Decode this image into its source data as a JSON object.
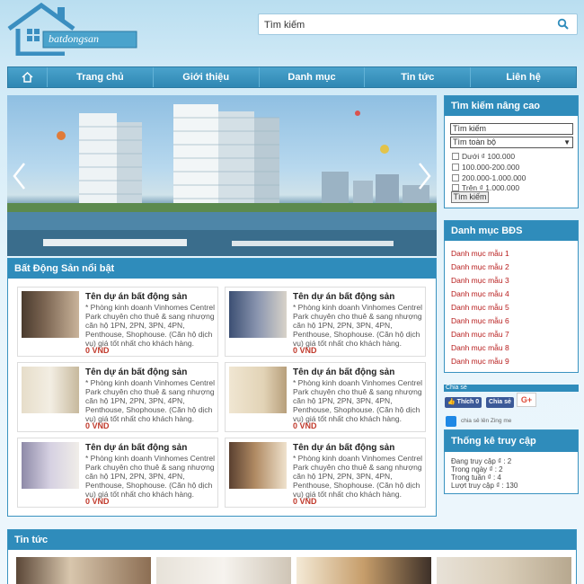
{
  "header": {
    "logo_text": "batdongsan",
    "search_placeholder": "Tìm kiếm",
    "search_icon": "search-icon"
  },
  "nav": {
    "home_icon": "home-icon",
    "items": [
      "Trang chủ",
      "Giới thiệu",
      "Danh mục",
      "Tin tức",
      "Liên hệ"
    ]
  },
  "slider": {
    "prev_icon": "chevron-left-icon",
    "next_icon": "chevron-right-icon"
  },
  "featured": {
    "title": "Bất Động Sản nổi bật",
    "cards": [
      {
        "title": "Tên dự án bất động sản",
        "desc": "* Phòng kinh doanh Vinhomes Centrel Park chuyên cho thuê & sang nhượng căn hộ 1PN, 2PN, 3PN, 4PN, Penthouse, Shophouse. (Căn hộ dịch vụ) giá tốt nhất cho khách hàng.",
        "price": "0 VND"
      },
      {
        "title": "Tên dự án bất động sản",
        "desc": "* Phòng kinh doanh Vinhomes Centrel Park chuyên cho thuê & sang nhượng căn hộ 1PN, 2PN, 3PN, 4PN, Penthouse, Shophouse. (Căn hộ dịch vụ) giá tốt nhất cho khách hàng.",
        "price": "0 VND"
      },
      {
        "title": "Tên dự án bất động sản",
        "desc": "* Phòng kinh doanh Vinhomes Centrel Park chuyên cho thuê & sang nhượng căn hộ 1PN, 2PN, 3PN, 4PN, Penthouse, Shophouse. (Căn hộ dịch vụ) giá tốt nhất cho khách hàng.",
        "price": "0 VND"
      },
      {
        "title": "Tên dự án bất động sản",
        "desc": "* Phòng kinh doanh Vinhomes Centrel Park chuyên cho thuê & sang nhượng căn hộ 1PN, 2PN, 3PN, 4PN, Penthouse, Shophouse. (Căn hộ dịch vụ) giá tốt nhất cho khách hàng.",
        "price": "0 VND"
      },
      {
        "title": "Tên dự án bất động sản",
        "desc": "* Phòng kinh doanh Vinhomes Centrel Park chuyên cho thuê & sang nhượng căn hộ 1PN, 2PN, 3PN, 4PN, Penthouse, Shophouse. (Căn hộ dịch vụ) giá tốt nhất cho khách hàng.",
        "price": "0 VND"
      },
      {
        "title": "Tên dự án bất động sản",
        "desc": "* Phòng kinh doanh Vinhomes Centrel Park chuyên cho thuê & sang nhượng căn hộ 1PN, 2PN, 3PN, 4PN, Penthouse, Shophouse. (Căn hộ dịch vụ) giá tốt nhất cho khách hàng.",
        "price": "0 VND"
      }
    ]
  },
  "advanced_search": {
    "title": "Tìm kiếm nâng cao",
    "keyword_value": "Tìm kiếm",
    "scope_value": "Tìm toàn bộ",
    "price_options": [
      "Dưới ₫ 100.000",
      "100.000-200.000",
      "200.000-1.000.000",
      "Trên ₫ 1.000.000"
    ],
    "submit_label": "Tìm kiếm"
  },
  "categories": {
    "title": "Danh mục BĐS",
    "items": [
      "Danh mục mẫu 1",
      "Danh mục mẫu 2",
      "Danh mục mẫu 3",
      "Danh mục mẫu 4",
      "Danh mục mẫu 5",
      "Danh mục mẫu 6",
      "Danh mục mẫu 7",
      "Danh mục mẫu 8",
      "Danh mục mẫu 9"
    ]
  },
  "share": {
    "label": "Chia sẻ",
    "fb_like": "Thích 0",
    "fb_share": "Chia sẻ",
    "gplus": "G+",
    "zing_text": "chia sẻ lên Zing me"
  },
  "stats": {
    "title": "Thống kê truy cập",
    "online": "Đang truy cập ₫ : 2",
    "today": "Trong ngày ₫ : 2",
    "week": "Trong tuần ₫ : 4",
    "total": "Lượt truy cập ₫ : 130"
  },
  "news": {
    "title": "Tin tức"
  },
  "colors": {
    "primary": "#2f8cbb",
    "price": "#c0392b",
    "category_link": "#b71c1c"
  }
}
